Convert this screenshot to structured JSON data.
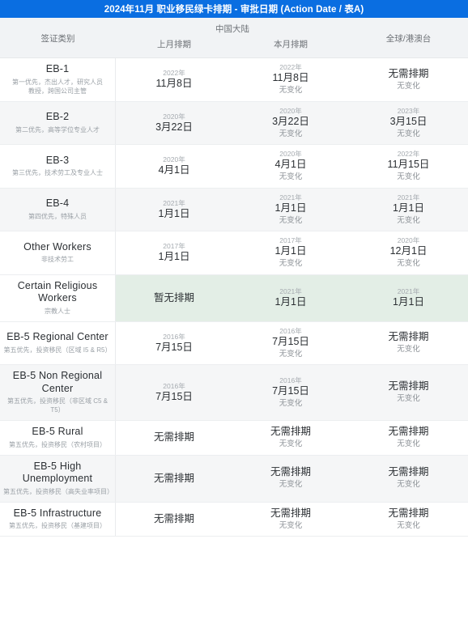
{
  "title": "2024年11月 职业移民绿卡排期 - 审批日期 (Action Date / 表A)",
  "colors": {
    "titlebar_bg": "#0a6ee1",
    "header_bg": "#f1f3f5",
    "alt_row_bg": "#f5f6f7",
    "highlight_bg": "#e3eee6"
  },
  "header": {
    "category": "签证类别",
    "china_group": "中国大陆",
    "prev_month": "上月排期",
    "curr_month": "本月排期",
    "global": "全球/港澳台"
  },
  "rows": [
    {
      "name": "EB-1",
      "desc": "第一优先，杰出人才，研究人员\n教授，跨国公司主管",
      "prev": {
        "year": "2022年",
        "date": "11月8日",
        "note": ""
      },
      "curr": {
        "year": "2022年",
        "date": "11月8日",
        "note": "无变化"
      },
      "global": {
        "year": "",
        "date": "无需排期",
        "note": "无变化"
      },
      "alt": false,
      "highlight": false
    },
    {
      "name": "EB-2",
      "desc": "第二优先，高等学位专业人才",
      "prev": {
        "year": "2020年",
        "date": "3月22日",
        "note": ""
      },
      "curr": {
        "year": "2020年",
        "date": "3月22日",
        "note": "无变化"
      },
      "global": {
        "year": "2023年",
        "date": "3月15日",
        "note": "无变化"
      },
      "alt": true,
      "highlight": false
    },
    {
      "name": "EB-3",
      "desc": "第三优先，技术劳工及专业人士",
      "prev": {
        "year": "2020年",
        "date": "4月1日",
        "note": ""
      },
      "curr": {
        "year": "2020年",
        "date": "4月1日",
        "note": "无变化"
      },
      "global": {
        "year": "2022年",
        "date": "11月15日",
        "note": "无变化"
      },
      "alt": false,
      "highlight": false
    },
    {
      "name": "EB-4",
      "desc": "第四优先，特殊人员",
      "prev": {
        "year": "2021年",
        "date": "1月1日",
        "note": ""
      },
      "curr": {
        "year": "2021年",
        "date": "1月1日",
        "note": "无变化"
      },
      "global": {
        "year": "2021年",
        "date": "1月1日",
        "note": "无变化"
      },
      "alt": true,
      "highlight": false
    },
    {
      "name": "Other Workers",
      "desc": "非技术劳工",
      "prev": {
        "year": "2017年",
        "date": "1月1日",
        "note": ""
      },
      "curr": {
        "year": "2017年",
        "date": "1月1日",
        "note": "无变化"
      },
      "global": {
        "year": "2020年",
        "date": "12月1日",
        "note": "无变化"
      },
      "alt": false,
      "highlight": false
    },
    {
      "name": "Certain Religious Workers",
      "desc": "宗教人士",
      "prev": {
        "year": "",
        "date": "暂无排期",
        "note": ""
      },
      "curr": {
        "year": "2021年",
        "date": "1月1日",
        "note": ""
      },
      "global": {
        "year": "2021年",
        "date": "1月1日",
        "note": ""
      },
      "alt": false,
      "highlight": true
    },
    {
      "name": "EB-5 Regional Center",
      "desc": "第五优先，投资移民（区域 I5 & R5）",
      "prev": {
        "year": "2016年",
        "date": "7月15日",
        "note": ""
      },
      "curr": {
        "year": "2016年",
        "date": "7月15日",
        "note": "无变化"
      },
      "global": {
        "year": "",
        "date": "无需排期",
        "note": "无变化"
      },
      "alt": false,
      "highlight": false
    },
    {
      "name": "EB-5 Non Regional Center",
      "desc": "第五优先，投资移民（非区域 C5 & T5）",
      "prev": {
        "year": "2016年",
        "date": "7月15日",
        "note": ""
      },
      "curr": {
        "year": "2016年",
        "date": "7月15日",
        "note": "无变化"
      },
      "global": {
        "year": "",
        "date": "无需排期",
        "note": "无变化"
      },
      "alt": true,
      "highlight": false
    },
    {
      "name": "EB-5 Rural",
      "desc": "第五优先，投资移民（农村项目）",
      "prev": {
        "year": "",
        "date": "无需排期",
        "note": ""
      },
      "curr": {
        "year": "",
        "date": "无需排期",
        "note": "无变化"
      },
      "global": {
        "year": "",
        "date": "无需排期",
        "note": "无变化"
      },
      "alt": false,
      "highlight": false
    },
    {
      "name": "EB-5 High Unemployment",
      "desc": "第五优先，投资移民（高失业率项目）",
      "prev": {
        "year": "",
        "date": "无需排期",
        "note": ""
      },
      "curr": {
        "year": "",
        "date": "无需排期",
        "note": "无变化"
      },
      "global": {
        "year": "",
        "date": "无需排期",
        "note": "无变化"
      },
      "alt": true,
      "highlight": false
    },
    {
      "name": "EB-5 Infrastructure",
      "desc": "第五优先，投资移民（基建项目）",
      "prev": {
        "year": "",
        "date": "无需排期",
        "note": ""
      },
      "curr": {
        "year": "",
        "date": "无需排期",
        "note": "无变化"
      },
      "global": {
        "year": "",
        "date": "无需排期",
        "note": "无变化"
      },
      "alt": false,
      "highlight": false
    }
  ]
}
